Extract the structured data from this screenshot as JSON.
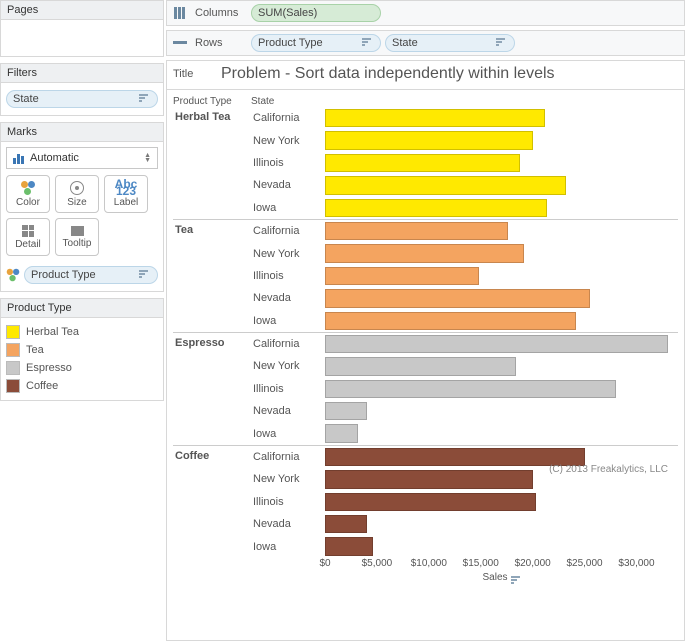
{
  "panels": {
    "pages": {
      "title": "Pages"
    },
    "filters": {
      "title": "Filters",
      "pill": "State"
    },
    "marks": {
      "title": "Marks",
      "automatic": "Automatic",
      "buttons": {
        "color": "Color",
        "size": "Size",
        "label": "Label",
        "detail": "Detail",
        "tooltip": "Tooltip"
      },
      "pill": "Product Type"
    },
    "legend": {
      "title": "Product Type",
      "items": [
        {
          "label": "Herbal Tea",
          "color": "#ffe900"
        },
        {
          "label": "Tea",
          "color": "#f4a460"
        },
        {
          "label": "Espresso",
          "color": "#c8c8c8"
        },
        {
          "label": "Coffee",
          "color": "#8b4c39"
        }
      ]
    }
  },
  "shelves": {
    "columns": {
      "label": "Columns",
      "pills": [
        {
          "text": "SUM(Sales)",
          "kind": "green"
        }
      ]
    },
    "rows": {
      "label": "Rows",
      "pills": [
        {
          "text": "Product Type",
          "kind": "blue",
          "sort": true
        },
        {
          "text": "State",
          "kind": "blue",
          "sort": true
        }
      ]
    }
  },
  "titlebar": {
    "label": "Title",
    "value": "Problem - Sort data independently within levels"
  },
  "copyright": "(C) 2013 Freakalytics, LLC",
  "axis": {
    "ticks": [
      "$0",
      "$5,000",
      "$10,000",
      "$15,000",
      "$20,000",
      "$25,000",
      "$30,000"
    ],
    "label": "Sales"
  },
  "headers": {
    "productType": "Product Type",
    "state": "State"
  },
  "chart_data": {
    "type": "bar",
    "xlabel": "Sales",
    "xlim": [
      0,
      34000
    ],
    "states": [
      "California",
      "New York",
      "Illinois",
      "Nevada",
      "Iowa"
    ],
    "series": [
      {
        "name": "Herbal Tea",
        "color": "#ffe900",
        "values": [
          21200,
          20000,
          18800,
          23200,
          21400
        ]
      },
      {
        "name": "Tea",
        "color": "#f4a460",
        "values": [
          17600,
          19200,
          14800,
          25500,
          24200
        ]
      },
      {
        "name": "Espresso",
        "color": "#c8c8c8",
        "values": [
          33000,
          18400,
          28000,
          4000,
          3200
        ]
      },
      {
        "name": "Coffee",
        "color": "#8b4c39",
        "values": [
          25000,
          20000,
          20300,
          4000,
          4600
        ]
      }
    ]
  }
}
